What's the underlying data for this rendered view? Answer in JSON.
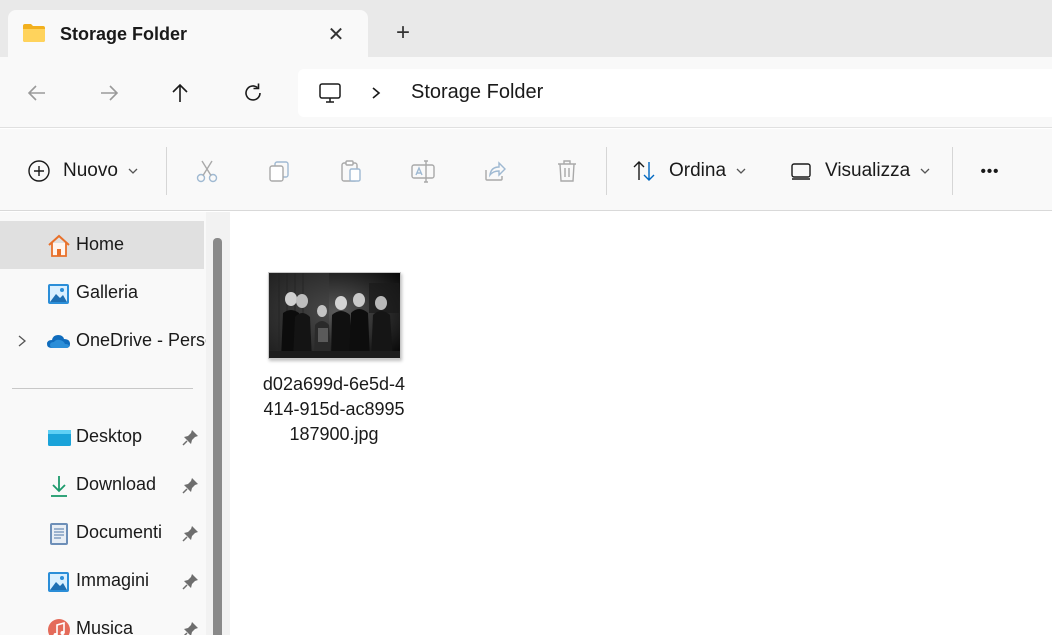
{
  "tab": {
    "title": "Storage Folder",
    "close_glyph": "✕",
    "new_tab_glyph": "+"
  },
  "address": {
    "crumb": "Storage Folder"
  },
  "toolbar": {
    "new_label": "Nuovo",
    "sort_label": "Ordina",
    "view_label": "Visualizza",
    "more_glyph": "•••"
  },
  "sidebar": {
    "items": [
      {
        "label": "Home",
        "icon": "home-icon"
      },
      {
        "label": "Galleria",
        "icon": "gallery-icon"
      },
      {
        "label": "OneDrive - Perso",
        "icon": "cloud-icon"
      },
      {
        "label": "Desktop",
        "icon": "desktop-icon"
      },
      {
        "label": "Download",
        "icon": "download-icon"
      },
      {
        "label": "Documenti",
        "icon": "document-icon"
      },
      {
        "label": "Immagini",
        "icon": "pictures-icon"
      },
      {
        "label": "Musica",
        "icon": "music-icon"
      }
    ]
  },
  "files": [
    {
      "name": "d02a699d-6e5d-4414-915d-ac8995187900.jpg"
    }
  ],
  "colors": {
    "accent": "#0067c0",
    "folder": "#f6c443",
    "tab_bg": "#e9e9e9",
    "selected": "#e0e0e0"
  }
}
